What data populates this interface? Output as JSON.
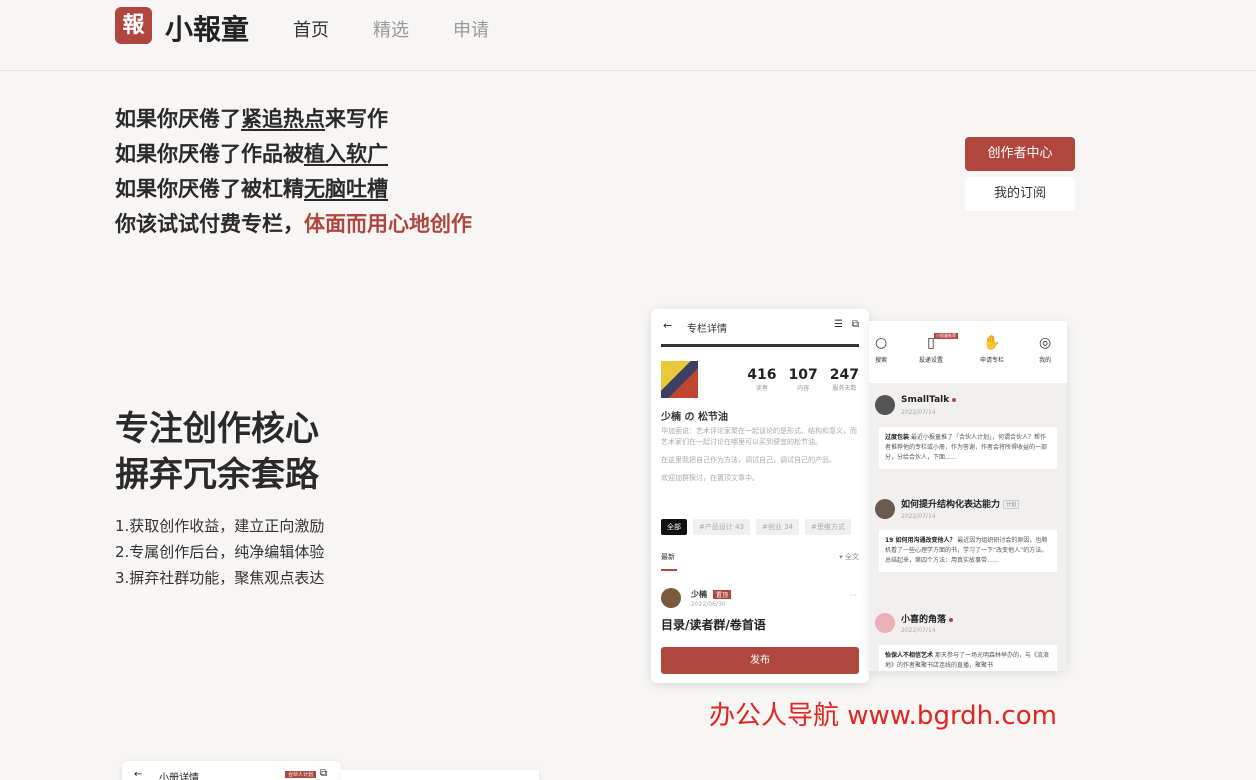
{
  "header": {
    "logo_char": "報",
    "brand": "小報童",
    "nav": [
      "首页",
      "精选",
      "申请"
    ]
  },
  "hero": {
    "line1": {
      "a": "如果你厌倦了",
      "u": "紧追热点",
      "b": "来写作"
    },
    "line2": {
      "a": "如果你厌倦了作品被",
      "u": "植入软广"
    },
    "line3": {
      "a": "如果你厌倦了被杠精",
      "u": "无脑吐槽"
    },
    "line4": {
      "a": "你该试试付费专栏，",
      "red": "体面而用心地创作"
    }
  },
  "actions": {
    "creator": "创作者中心",
    "subscriptions": "我的订阅"
  },
  "feature": {
    "title1": "专注创作核心",
    "title2": "摒弃冗余套路",
    "items": [
      "1.获取创作收益，建立正向激励",
      "2.专属创作后台，纯净编辑体验",
      "3.摒弃社群功能，聚焦观点表达"
    ]
  },
  "phone1": {
    "title": "专栏详情",
    "stats": [
      {
        "n": "416",
        "l": "读者"
      },
      {
        "n": "107",
        "l": "内容"
      },
      {
        "n": "247",
        "l": "服务天数"
      }
    ],
    "name": "少楠 の 松节油",
    "desc": [
      "毕加索说：艺术评论家聚在一起谈论的是形式、结构和意义，而艺术家们在一起讨论在哪里可以买到便宜的松节油。",
      "在这里我把自己作为方法，调试自己，调试自己的产品。",
      "欢迎加群探讨，在置顶文章中。"
    ],
    "tags": [
      "全部",
      "#产品设计 43",
      "#创业 34",
      "#思维方式"
    ],
    "latest": "最新",
    "all": "全文",
    "author": "少楠",
    "author_badge": "置顶",
    "author_date": "2022/06/30",
    "post_title": "目录/读者群/卷首语",
    "publish": "发布"
  },
  "phone2": {
    "tabs": [
      "搜索",
      "投递设置",
      "申请专栏",
      "我的"
    ],
    "hot_badge": "小报童推荐",
    "feed": [
      {
        "name": "SmallTalk",
        "date": "2022/07/14",
        "bold": "过度包装",
        "text": "最近小报童推了「合伙人计划」，何谓合伙人？帮作者推荐他的专栏或小册，作为答谢，作者会将所得收益的一部分，分给合伙人，下面……"
      },
      {
        "name": "如何提升结构化表达能力",
        "tag": "计划",
        "date": "2022/07/14",
        "bold": "19 如何用沟通改变他人？",
        "text": "最近因为组织研讨会的原因，也顺机看了一些心理学方面的书，学习了一下“改变他人”的方法。总结起来，第四个方法：用真实故事带……"
      },
      {
        "name": "小喜的角落",
        "date": "2022/07/14",
        "bold": "怡保人不相信艺术",
        "text": "那天参与了一场光明森林举办的，与《流浪地》的作者聚聚书店连线的直播，聚聚书"
      }
    ]
  },
  "watermark": "办公人导航 www.bgrdh.com",
  "peek": {
    "title": "小册详情",
    "tag": "合伙人计划"
  },
  "colors": {
    "accent": "#b0473e",
    "background": "#f7f6f4",
    "watermark": "#e0261f"
  }
}
